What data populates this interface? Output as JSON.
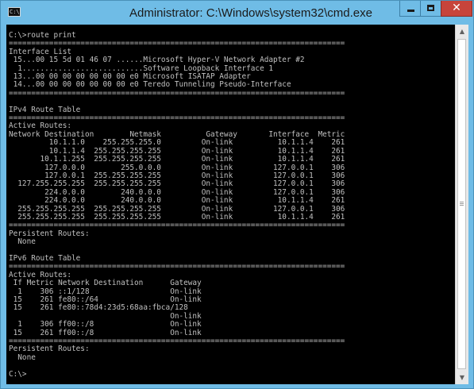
{
  "window": {
    "title": "Administrator: C:\\Windows\\system32\\cmd.exe",
    "icon_text": "C:\\",
    "close_glyph": "✕"
  },
  "console": {
    "lines": [
      "C:\\>route print",
      "===========================================================================",
      "Interface List",
      " 15...00 15 5d 01 46 07 ......Microsoft Hyper-V Network Adapter #2",
      "  1...........................Software Loopback Interface 1",
      " 13...00 00 00 00 00 00 00 e0 Microsoft ISATAP Adapter",
      " 14...00 00 00 00 00 00 00 e0 Teredo Tunneling Pseudo-Interface",
      "===========================================================================",
      "",
      "IPv4 Route Table",
      "===========================================================================",
      "Active Routes:",
      "Network Destination        Netmask          Gateway       Interface  Metric",
      "         10.1.1.0    255.255.255.0         On-link          10.1.1.4    261",
      "         10.1.1.4  255.255.255.255         On-link          10.1.1.4    261",
      "       10.1.1.255  255.255.255.255         On-link          10.1.1.4    261",
      "        127.0.0.0        255.0.0.0         On-link         127.0.0.1    306",
      "        127.0.0.1  255.255.255.255         On-link         127.0.0.1    306",
      "  127.255.255.255  255.255.255.255         On-link         127.0.0.1    306",
      "        224.0.0.0        240.0.0.0         On-link         127.0.0.1    306",
      "        224.0.0.0        240.0.0.0         On-link          10.1.1.4    261",
      "  255.255.255.255  255.255.255.255         On-link         127.0.0.1    306",
      "  255.255.255.255  255.255.255.255         On-link          10.1.1.4    261",
      "===========================================================================",
      "Persistent Routes:",
      "  None",
      "",
      "IPv6 Route Table",
      "===========================================================================",
      "Active Routes:",
      " If Metric Network Destination      Gateway",
      "  1    306 ::1/128                  On-link",
      " 15    261 fe80::/64                On-link",
      " 15    261 fe80::78d4:23d5:68aa:fbca/128",
      "                                    On-link",
      "  1    306 ff00::/8                 On-link",
      " 15    261 ff00::/8                 On-link",
      "===========================================================================",
      "Persistent Routes:",
      "  None",
      "",
      "C:\\>"
    ]
  },
  "colors": {
    "titlebar": "#6fbce6",
    "close_button": "#c7443b",
    "console_bg": "#000000",
    "console_text": "#c0c0c0"
  },
  "icons": {
    "minimize": "minimize-icon",
    "maximize": "maximize-icon",
    "close": "close-icon",
    "scroll_up": "scroll-up-arrow-icon",
    "scroll_down": "scroll-down-arrow-icon"
  }
}
